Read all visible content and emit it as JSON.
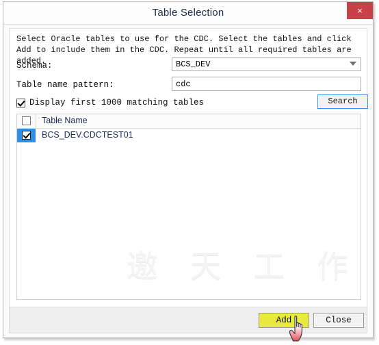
{
  "window": {
    "title": "Table Selection",
    "close_icon": "close-icon",
    "close_label": "×"
  },
  "instructions": "Select Oracle tables to use for the CDC. Select the tables and click Add to include them in the CDC. Repeat until all required tables are added.",
  "form": {
    "schema": {
      "label": "Schema:",
      "value": "BCS_DEV",
      "chevron_icon": "chevron-down-icon"
    },
    "pattern": {
      "label": "Table name pattern:",
      "value": "cdc",
      "placeholder": ""
    },
    "display_first": {
      "label": "Display first 1000 matching tables",
      "checked": true
    },
    "search_button": "Search"
  },
  "table": {
    "header_checkbox_checked": false,
    "columns": [
      "Table Name"
    ],
    "rows": [
      {
        "checked": true,
        "selected": true,
        "name": "BCS_DEV.CDCTEST01"
      }
    ]
  },
  "watermark": "邀 天 工 作 室",
  "footer": {
    "add_label": "Add",
    "close_label": "Close"
  },
  "colors": {
    "title_text": "#1b2a50",
    "close_button": "#c84148",
    "selection": "#2f8fe6",
    "add_button": "#e9e940",
    "focus_border": "#3c94e8"
  }
}
